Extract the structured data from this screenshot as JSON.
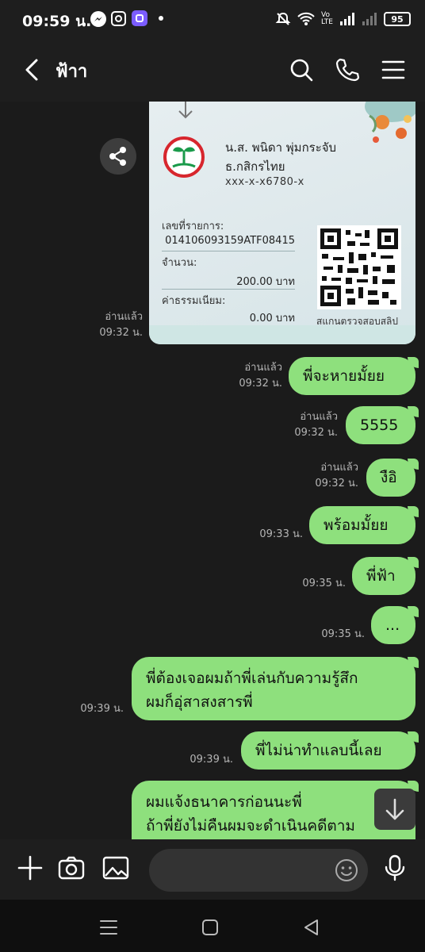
{
  "status_bar": {
    "time": "09:59 น.",
    "apps": [
      "messenger-icon",
      "instagram-icon",
      "app-icon"
    ],
    "battery": "95"
  },
  "header": {
    "title": "ฟ้าา",
    "icons": [
      "back-arrow-icon",
      "search-icon",
      "phone-icon",
      "menu-icon"
    ]
  },
  "slip": {
    "name": "น.ส. พนิดา พุ่มกระจับ",
    "bank": "ธ.กสิกรไทย",
    "account": "xxx-x-x6780-x",
    "ref_label": "เลขที่รายการ:",
    "ref_value": "014106093159ATF08415",
    "amount_label": "จำนวน:",
    "amount_value": "200.00 บาท",
    "fee_label": "ค่าธรรมเนียม:",
    "fee_value": "0.00 บาท",
    "qr_caption": "สแกนตรวจสอบสลิป",
    "read": "อ่านแล้ว",
    "time": "09:32 น."
  },
  "messages": [
    {
      "text": "พี่จะหายมั้ยย",
      "read": "อ่านแล้ว",
      "time": "09:32 น."
    },
    {
      "text": "5555",
      "read": "อ่านแล้ว",
      "time": "09:32 น."
    },
    {
      "text": "งือิ",
      "read": "อ่านแล้ว",
      "time": "09:32 น."
    },
    {
      "text": "พร้อมมั้ยย",
      "read": "",
      "time": "09:33 น."
    },
    {
      "text": "พี่ฟ้า",
      "read": "",
      "time": "09:35 น."
    },
    {
      "text": "...",
      "read": "",
      "time": "09:35 น."
    },
    {
      "text": "พี่ต้องเจอผมถ้าพี่เล่นกับความรู้สึก\nผมก็อุ่สาสงสารพี่",
      "read": "",
      "time": "09:39 น."
    },
    {
      "text": "พี่ไม่น่าทำแลบนี้เลย",
      "read": "",
      "time": "09:39 น."
    },
    {
      "text": "ผมแจ้งธนาคารก่อนนะพี่\nถ้าพี่ยังไม่คืนผมจะดำเนินคดีตาม",
      "read": "",
      "time": ""
    }
  ],
  "input_bar": {
    "icons": [
      "plus-icon",
      "camera-icon",
      "image-icon",
      "emoji-icon",
      "mic-icon"
    ],
    "placeholder": ""
  }
}
